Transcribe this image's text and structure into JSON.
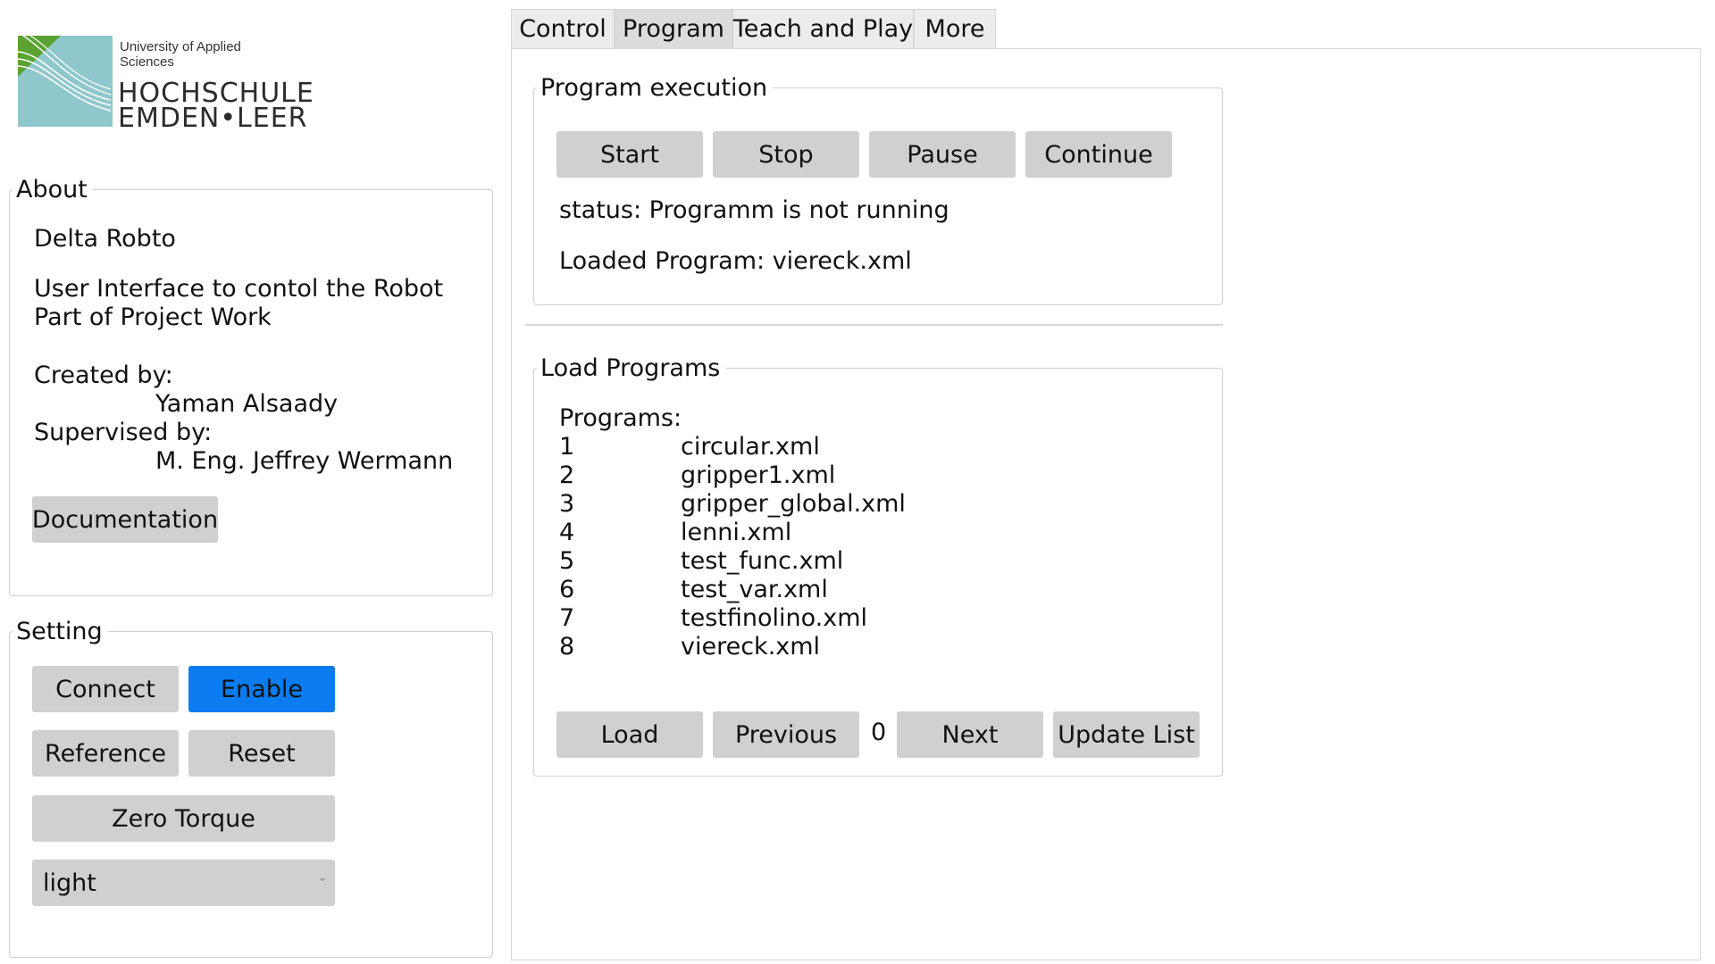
{
  "logo": {
    "subtitle": "University of Applied Sciences",
    "line1": "HOCHSCHULE",
    "line2": "EMDEN•LEER",
    "colors": {
      "green": "#5aa332",
      "teal": "#8ec7cc"
    }
  },
  "about": {
    "legend": "About",
    "title": "Delta Robto",
    "description_line1": "User Interface to contol the Robot",
    "description_line2": "Part of Project Work",
    "created_label": "Created by:",
    "created_name": "Yaman Alsaady",
    "supervised_label": "Supervised by:",
    "supervised_name": "M. Eng. Jeffrey Wermann",
    "documentation_button": "Documentation"
  },
  "setting": {
    "legend": "Setting",
    "connect_button": "Connect",
    "enable_button": "Enable",
    "reference_button": "Reference",
    "reset_button": "Reset",
    "zero_torque_button": "Zero Torque",
    "theme_select": "light",
    "accent_color": "#0a7cf0"
  },
  "tabs": [
    {
      "label": "Control"
    },
    {
      "label": "Program"
    },
    {
      "label": "Teach and Play"
    },
    {
      "label": "More"
    }
  ],
  "program_execution": {
    "legend": "Program execution",
    "start_button": "Start",
    "stop_button": "Stop",
    "pause_button": "Pause",
    "continue_button": "Continue",
    "status": "status: Programm is not running",
    "loaded": "Loaded Program: viereck.xml"
  },
  "load_programs": {
    "legend": "Load Programs",
    "header": "Programs:",
    "items": [
      {
        "num": "1",
        "name": "circular.xml"
      },
      {
        "num": "2",
        "name": "gripper1.xml"
      },
      {
        "num": "3",
        "name": "gripper_global.xml"
      },
      {
        "num": "4",
        "name": "lenni.xml"
      },
      {
        "num": "5",
        "name": "test_func.xml"
      },
      {
        "num": "6",
        "name": "test_var.xml"
      },
      {
        "num": "7",
        "name": "testfinolino.xml"
      },
      {
        "num": "8",
        "name": "viereck.xml"
      }
    ],
    "load_button": "Load",
    "previous_button": "Previous",
    "index": "0",
    "next_button": "Next",
    "update_button": "Update List"
  }
}
